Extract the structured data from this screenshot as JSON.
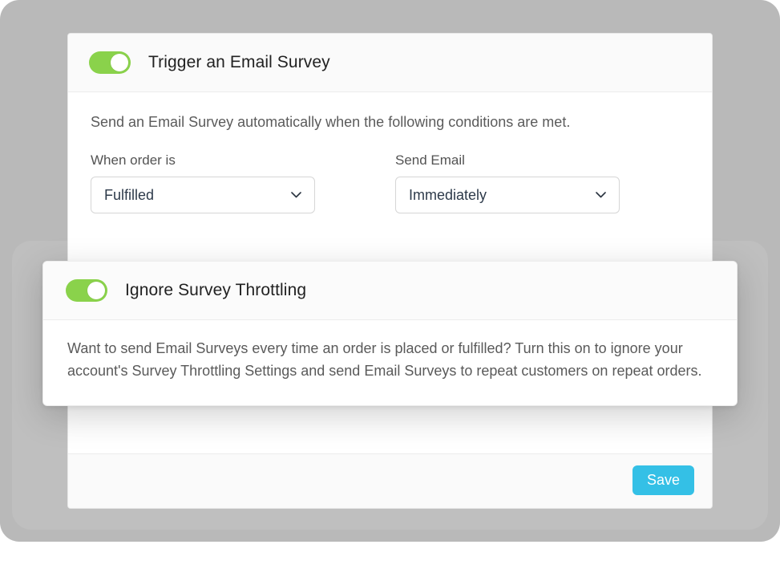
{
  "trigger": {
    "title": "Trigger an Email Survey",
    "description": "Send an Email Survey automatically when the following conditions are met.",
    "orderLabel": "When order is",
    "orderValue": "Fulfilled",
    "sendLabel": "Send Email",
    "sendValue": "Immediately"
  },
  "throttle": {
    "title": "Ignore Survey Throttling",
    "description": "Want to send Email Surveys every time an order is placed or fulfilled? Turn this on to ignore your account's Survey Throttling Settings and send Email Surveys to repeat customers on repeat orders."
  },
  "footer": {
    "save": "Save"
  }
}
